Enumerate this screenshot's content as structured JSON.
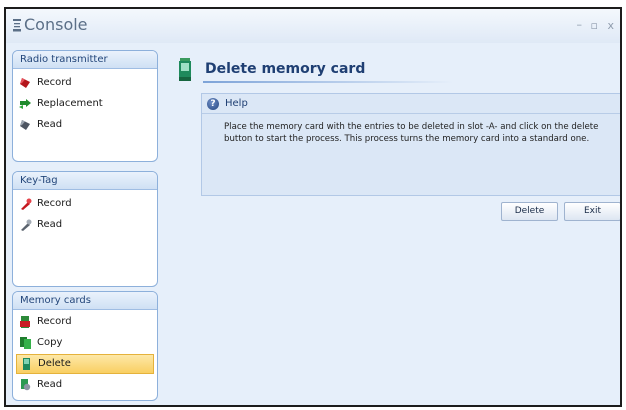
{
  "window": {
    "title": "Console",
    "minimize": "–",
    "maximize": "▫",
    "close": "x"
  },
  "sidebar": {
    "panels": [
      {
        "header": "Radio transmitter",
        "items": [
          {
            "label": "Record",
            "icon": "red-transmitter-icon"
          },
          {
            "label": "Replacement",
            "icon": "green-arrows-icon"
          },
          {
            "label": "Read",
            "icon": "grey-transmitter-icon"
          }
        ]
      },
      {
        "header": "Key-Tag",
        "items": [
          {
            "label": "Record",
            "icon": "red-keytag-icon"
          },
          {
            "label": "Read",
            "icon": "grey-keytag-icon"
          }
        ]
      },
      {
        "header": "Memory cards",
        "items": [
          {
            "label": "Record",
            "icon": "red-memory-card-icon"
          },
          {
            "label": "Copy",
            "icon": "green-memory-card-icon"
          },
          {
            "label": "Delete",
            "icon": "delete-memory-card-icon",
            "active": true
          },
          {
            "label": "Read",
            "icon": "read-memory-card-icon"
          }
        ]
      }
    ]
  },
  "main": {
    "title": "Delete memory card",
    "help": {
      "heading": "Help",
      "text": "Place the memory card with the entries to be deleted in slot -A- and click on the delete button to start the process. This process turns the memory card into a standard one."
    },
    "buttons": {
      "delete": "Delete",
      "exit": "Exit"
    }
  },
  "colors": {
    "accent": "#1f3f73",
    "active_item": "#f9cf62",
    "panel_border": "#8db0db",
    "window_bg": "#e6effa"
  }
}
